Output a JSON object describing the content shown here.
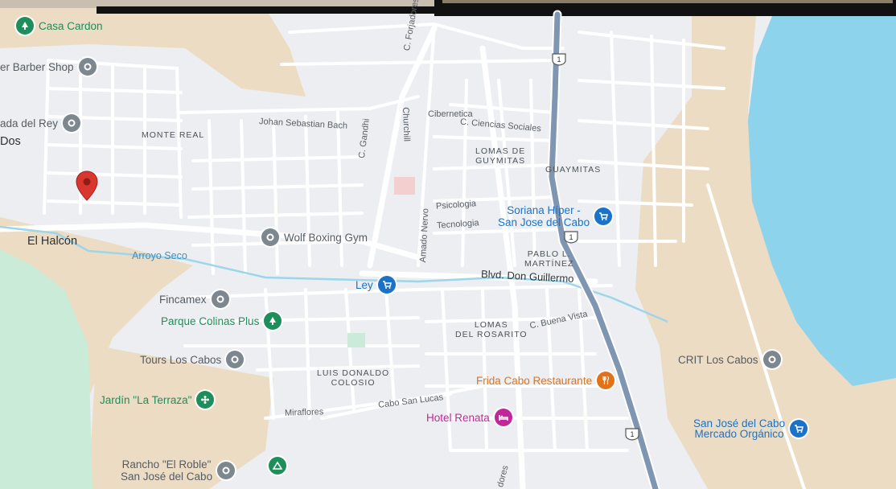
{
  "map": {
    "places": {
      "el_halcon": "El Halcón",
      "dos": "Dos"
    },
    "neighborhoods": {
      "monte_real": "MONTE REAL",
      "lomas_guymitas_1": "LOMAS DE",
      "lomas_guymitas_2": "GUYMITAS",
      "guaymitas": "GUAYMITAS",
      "pablo_l_1": "PABLO L.",
      "pablo_l_2": "MARTÍNEZ",
      "lomas_rosarito_1": "LOMAS",
      "lomas_rosarito_2": "DEL ROSARITO",
      "luis_donaldo_1": "LUIS DONALDO",
      "luis_donaldo_2": "COLOSIO"
    },
    "streets": {
      "johan": "Johan Sebastian Bach",
      "forjadores": "C. Forjadores",
      "gandhi": "C. Gandhi",
      "churchill": "Churchill",
      "cibernetica": "Cibernetica",
      "ciencias": "C. Ciencias Sociales",
      "psicologia": "Psicologia",
      "tecnologia": "Tecnologia",
      "amado_nervo": "Amado Nervo",
      "arroyo_seco": "Arroyo Seco",
      "blvd": "Blvd. Don Guillermo",
      "buena_vista": "C. Buena Vista",
      "cabo_san_lucas": "Cabo San Lucas",
      "miraflores": "Miraflores",
      "forjadores_bottom": "dores"
    },
    "highway_number": "1",
    "pois": {
      "casa_cardon": "Casa Cardon",
      "barber": "er Barber Shop",
      "rey": "ada del Rey",
      "wolf": "Wolf Boxing Gym",
      "soriana_1": "Soriana Híper -",
      "soriana_2": "San Jose del Cabo",
      "ley": "Ley",
      "fincamex": "Fincamex",
      "parque": "Parque Colinas Plus",
      "tours": "Tours Los Cabos",
      "jardin": "Jardín \"La Terraza\"",
      "frida": "Frida Cabo Restaurante",
      "hotel": "Hotel Renata",
      "crit": "CRIT Los Cabos",
      "mercado_1": "San José del Cabo",
      "mercado_2": "Mercado Orgánico",
      "rancho_1": "Rancho \"El Roble\"",
      "rancho_2": "San José del Cabo"
    },
    "colors": {
      "water": "#8dd3ec",
      "green_area": "#c9ebd7",
      "sand": "#ecdcc3",
      "road": "#ffffff",
      "highway": "#7f96b3",
      "marker": "#d8362f"
    }
  }
}
